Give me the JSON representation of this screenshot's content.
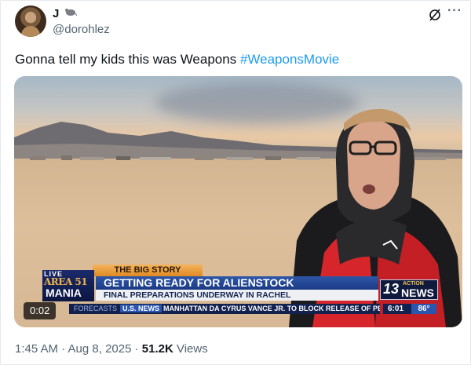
{
  "tweet": {
    "author_name": "J",
    "author_handle": "@dorohlez",
    "text_plain": "Gonna tell my kids this was Weapons ",
    "hashtag": "#WeaponsMovie",
    "timestamp": "1:45 AM · Aug 8, 2025 · ",
    "views_count": "51.2K",
    "views_label": " Views"
  },
  "video": {
    "duration": "0:02",
    "overlay": {
      "big_story": "THE BIG STORY",
      "live": "LIVE",
      "area": "AREA 51",
      "mania": "MANIA",
      "headline": "GETTING READY FOR ALIENSTOCK",
      "subhead": "FINAL PREPARATIONS UNDERWAY IN RACHEL",
      "ticker_label": "FORECASTS",
      "ticker_section": "U.S. NEWS",
      "ticker_story": "MANHATTAN DA CYRUS VANCE JR. TO BLOCK RELEASE OF PERS",
      "station_number": "13",
      "station_action": "ACTION",
      "station_news": "NEWS",
      "clock": "6:01",
      "temperature": "86°"
    }
  },
  "icons": {
    "more": "more-options-icon",
    "grok": "grok-icon",
    "name_emoji": "rodent-emoji-icon"
  },
  "colors": {
    "link": "#1d9bf0",
    "muted": "#536471",
    "text": "#0f1419"
  }
}
